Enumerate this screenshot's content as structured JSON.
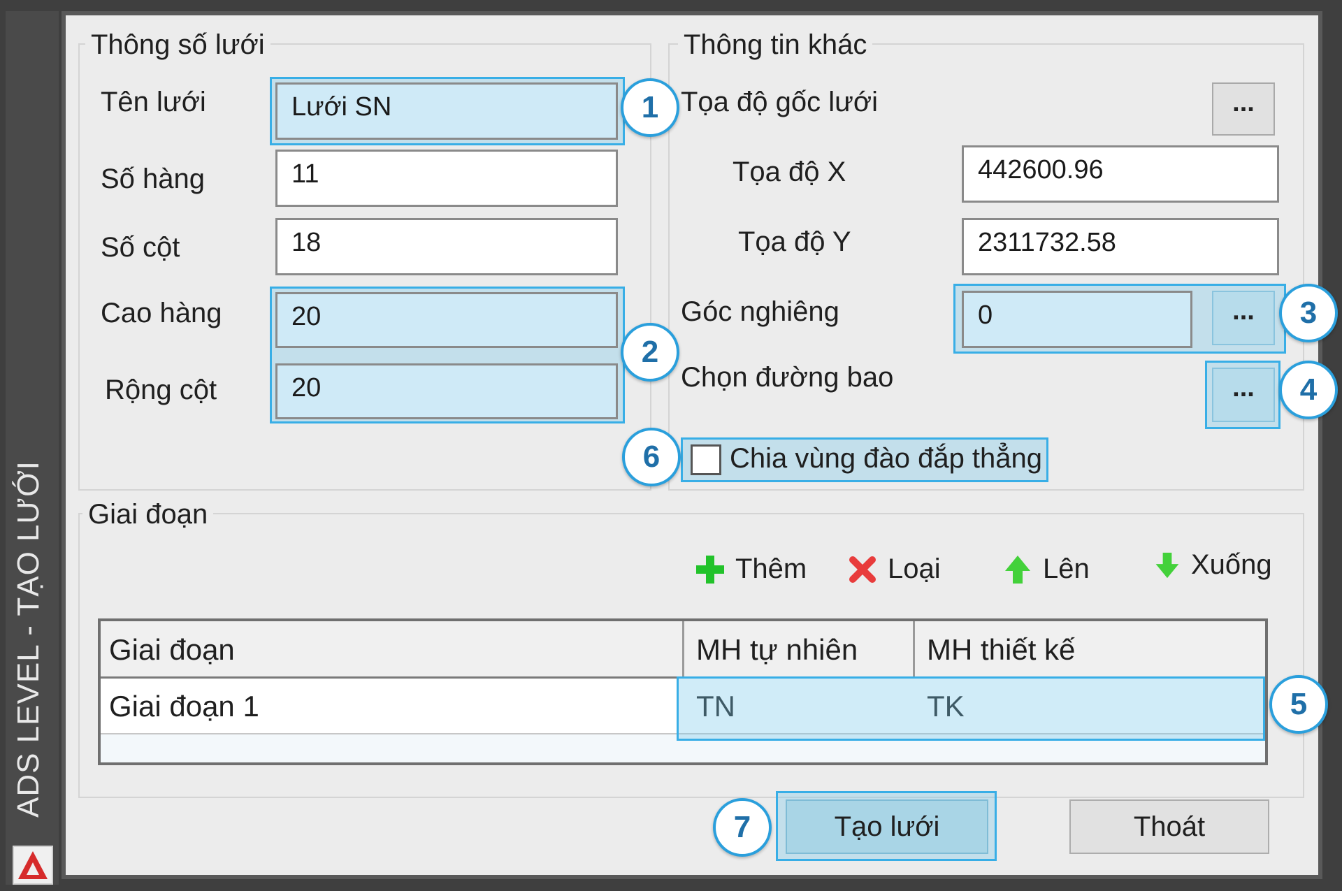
{
  "window": {
    "side_title": "ADS LEVEL - TẠO LƯỚI",
    "logo_icon": "autocad-logo"
  },
  "grid_params": {
    "title": "Thông số lưới",
    "fields": [
      {
        "label": "Tên lưới",
        "value": "Lưới SN"
      },
      {
        "label": "Số hàng",
        "value": "11"
      },
      {
        "label": "Số cột",
        "value": "18"
      },
      {
        "label": "Cao hàng",
        "value": "20"
      },
      {
        "label": "Rộng cột",
        "value": "20"
      }
    ]
  },
  "other_info": {
    "title": "Thông tin khác",
    "origin_label": "Tọa độ gốc lưới",
    "origin_button": "...",
    "x_label": "Tọa độ X",
    "x_value": "442600.96",
    "y_label": "Tọa độ Y",
    "y_value": "2311732.58",
    "angle_label": "Góc nghiêng",
    "angle_value": "0",
    "angle_button": "...",
    "boundary_label": "Chọn đường bao",
    "boundary_button": "...",
    "checkbox_label": "Chia vùng đào đắp thẳng",
    "checkbox_checked": false
  },
  "stages": {
    "title": "Giai đoạn",
    "toolbar": [
      {
        "label": "Thêm",
        "icon": "plus-icon",
        "color": "#22c22a"
      },
      {
        "label": "Loại",
        "icon": "delete-icon",
        "color": "#e83c3c"
      },
      {
        "label": "Lên",
        "icon": "arrow-up-icon",
        "color": "#43d13a"
      },
      {
        "label": "Xuống",
        "icon": "arrow-down-icon",
        "color": "#43d13a"
      }
    ],
    "columns": [
      "Giai đoạn",
      "MH tự nhiên",
      "MH thiết kế"
    ],
    "rows": [
      [
        "Giai đoạn 1",
        "TN",
        "TK"
      ]
    ]
  },
  "buttons": {
    "create": "Tạo lưới",
    "exit": "Thoát"
  },
  "callouts": [
    "1",
    "2",
    "3",
    "4",
    "5",
    "6",
    "7"
  ],
  "colors": {
    "highlight": "#38aee6",
    "dialog_bg": "#ececec"
  }
}
